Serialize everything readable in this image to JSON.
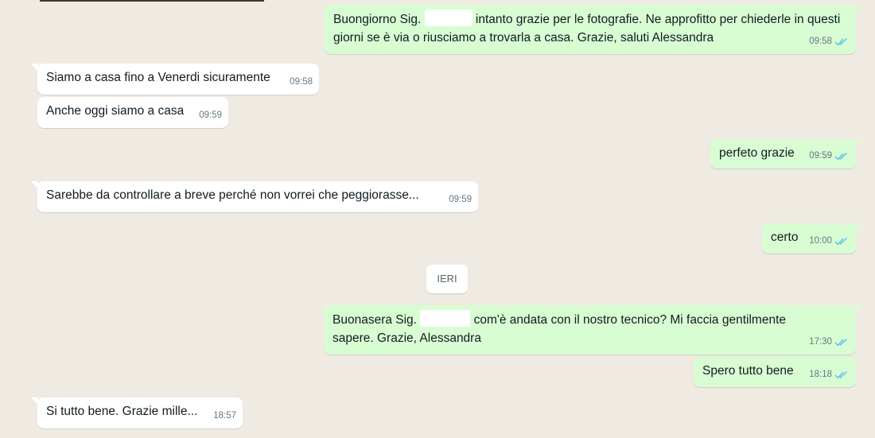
{
  "divider": {
    "label": "IERI"
  },
  "messages": {
    "m1": {
      "text_a": "Buongiorno Sig. ",
      "text_b": " intanto grazie per le fotografie. Ne approfitto per chiederle in questi giorni se è via o riusciamo a trovarla a casa. Grazie, saluti Alessandra",
      "time": "09:58",
      "direction": "outgoing",
      "read": true
    },
    "m2": {
      "text": "Siamo a casa fino a Venerdi sicuramente",
      "time": "09:58",
      "direction": "incoming"
    },
    "m3": {
      "text": "Anche oggi siamo a casa",
      "time": "09:59",
      "direction": "incoming"
    },
    "m4": {
      "text": "perfeto grazie",
      "time": "09:59",
      "direction": "outgoing",
      "read": true
    },
    "m5": {
      "text": "Sarebbe da controllare a breve perché non vorrei che peggiorasse...",
      "time": "09:59",
      "direction": "incoming"
    },
    "m6": {
      "text": "certo",
      "time": "10:00",
      "direction": "outgoing",
      "read": true
    },
    "m7": {
      "text_a": "Buonasera Sig. ",
      "text_b": " com'è andata con il nostro tecnico? Mi faccia gentilmente sapere. Grazie, Alessandra",
      "time": "17:30",
      "direction": "outgoing",
      "read": true
    },
    "m8": {
      "text": "Spero tutto bene",
      "time": "18:18",
      "direction": "outgoing",
      "read": true
    },
    "m9": {
      "text": "Si tutto bene. Grazie mille...",
      "time": "18:57",
      "direction": "incoming"
    }
  },
  "colors": {
    "background": "#efeae2",
    "outgoing_bubble": "#d9fdd3",
    "incoming_bubble": "#ffffff",
    "read_ticks": "#53bdeb",
    "timestamp": "#667781"
  },
  "icons": {
    "read_receipt": "double-check-icon"
  }
}
